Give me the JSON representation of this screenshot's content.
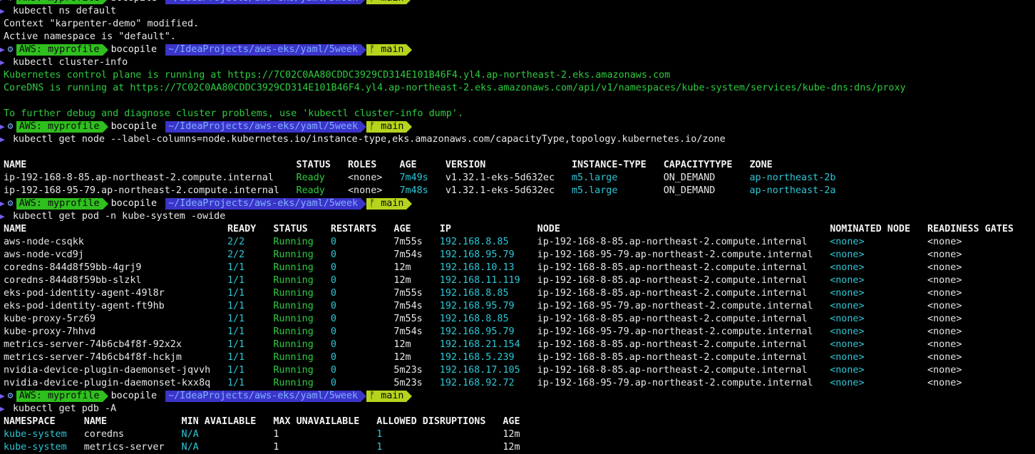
{
  "prompt": {
    "gear": "⚙",
    "aws": "AWS: myprofile",
    "user": "bocopile",
    "path": "~/IdeaProjects/aws-eks/yaml/5week",
    "git": "ᚠ main"
  },
  "cmds": {
    "ns": "kubectl ns default",
    "cluster": "kubectl cluster-info",
    "node": "kubectl get node --label-columns=node.kubernetes.io/instance-type,eks.amazonaws.com/capacityType,topology.kubernetes.io/zone",
    "pod": "kubectl get pod -n kube-system -owide",
    "pdb": "kubectl get pdb -A"
  },
  "ns_out": [
    "Context \"karpenter-demo\" modified.",
    "Active namespace is \"default\"."
  ],
  "cluster_out": [
    "Kubernetes control plane is running at https://7C02C0AA80CDDC3929CD314E101B46F4.yl4.ap-northeast-2.eks.amazonaws.com",
    "CoreDNS is running at https://7C02C0AA80CDDC3929CD314E101B46F4.yl4.ap-northeast-2.eks.amazonaws.com/api/v1/namespaces/kube-system/services/kube-dns:dns/proxy",
    "To further debug and diagnose cluster problems, use 'kubectl cluster-info dump'."
  ],
  "nodes": {
    "headers": [
      "NAME",
      "STATUS",
      "ROLES",
      "AGE",
      "VERSION",
      "INSTANCE-TYPE",
      "CAPACITYTYPE",
      "ZONE"
    ],
    "rows": [
      [
        "ip-192-168-8-85.ap-northeast-2.compute.internal",
        "Ready",
        "<none>",
        "7m49s",
        "v1.32.1-eks-5d632ec",
        "m5.large",
        "ON_DEMAND",
        "ap-northeast-2b"
      ],
      [
        "ip-192-168-95-79.ap-northeast-2.compute.internal",
        "Ready",
        "<none>",
        "7m48s",
        "v1.32.1-eks-5d632ec",
        "m5.large",
        "ON_DEMAND",
        "ap-northeast-2a"
      ]
    ]
  },
  "pods": {
    "headers": [
      "NAME",
      "READY",
      "STATUS",
      "RESTARTS",
      "AGE",
      "IP",
      "NODE",
      "NOMINATED NODE",
      "READINESS GATES"
    ],
    "rows": [
      [
        "aws-node-csqkk",
        "2/2",
        "Running",
        "0",
        "7m55s",
        "192.168.8.85",
        "ip-192-168-8-85.ap-northeast-2.compute.internal",
        "<none>",
        "<none>"
      ],
      [
        "aws-node-vcd9j",
        "2/2",
        "Running",
        "0",
        "7m54s",
        "192.168.95.79",
        "ip-192-168-95-79.ap-northeast-2.compute.internal",
        "<none>",
        "<none>"
      ],
      [
        "coredns-844d8f59bb-4grj9",
        "1/1",
        "Running",
        "0",
        "12m",
        "192.168.10.13",
        "ip-192-168-8-85.ap-northeast-2.compute.internal",
        "<none>",
        "<none>"
      ],
      [
        "coredns-844d8f59bb-slzkl",
        "1/1",
        "Running",
        "0",
        "12m",
        "192.168.11.119",
        "ip-192-168-8-85.ap-northeast-2.compute.internal",
        "<none>",
        "<none>"
      ],
      [
        "eks-pod-identity-agent-49l8r",
        "1/1",
        "Running",
        "0",
        "7m55s",
        "192.168.8.85",
        "ip-192-168-8-85.ap-northeast-2.compute.internal",
        "<none>",
        "<none>"
      ],
      [
        "eks-pod-identity-agent-ft9hb",
        "1/1",
        "Running",
        "0",
        "7m54s",
        "192.168.95.79",
        "ip-192-168-95-79.ap-northeast-2.compute.internal",
        "<none>",
        "<none>"
      ],
      [
        "kube-proxy-5rz69",
        "1/1",
        "Running",
        "0",
        "7m55s",
        "192.168.8.85",
        "ip-192-168-8-85.ap-northeast-2.compute.internal",
        "<none>",
        "<none>"
      ],
      [
        "kube-proxy-7hhvd",
        "1/1",
        "Running",
        "0",
        "7m54s",
        "192.168.95.79",
        "ip-192-168-95-79.ap-northeast-2.compute.internal",
        "<none>",
        "<none>"
      ],
      [
        "metrics-server-74b6cb4f8f-92x2x",
        "1/1",
        "Running",
        "0",
        "12m",
        "192.168.21.154",
        "ip-192-168-8-85.ap-northeast-2.compute.internal",
        "<none>",
        "<none>"
      ],
      [
        "metrics-server-74b6cb4f8f-hckjm",
        "1/1",
        "Running",
        "0",
        "12m",
        "192.168.5.239",
        "ip-192-168-8-85.ap-northeast-2.compute.internal",
        "<none>",
        "<none>"
      ],
      [
        "nvidia-device-plugin-daemonset-jqvvh",
        "1/1",
        "Running",
        "0",
        "5m23s",
        "192.168.17.105",
        "ip-192-168-8-85.ap-northeast-2.compute.internal",
        "<none>",
        "<none>"
      ],
      [
        "nvidia-device-plugin-daemonset-kxx8q",
        "1/1",
        "Running",
        "0",
        "5m23s",
        "192.168.92.72",
        "ip-192-168-95-79.ap-northeast-2.compute.internal",
        "<none>",
        "<none>"
      ]
    ]
  },
  "pdb": {
    "headers": [
      "NAMESPACE",
      "NAME",
      "MIN AVAILABLE",
      "MAX UNAVAILABLE",
      "ALLOWED DISRUPTIONS",
      "AGE"
    ],
    "rows": [
      [
        "kube-system",
        "coredns",
        "N/A",
        "1",
        "1",
        "12m"
      ],
      [
        "kube-system",
        "metrics-server",
        "N/A",
        "1",
        "1",
        "12m"
      ]
    ]
  },
  "colors": {
    "green": "#2ecc40",
    "cyan": "#2ec7d6",
    "aws": "#2fbf1e",
    "path": "#3b34c9",
    "git": "#b6d41e",
    "chevron": "#7a5cf4"
  }
}
